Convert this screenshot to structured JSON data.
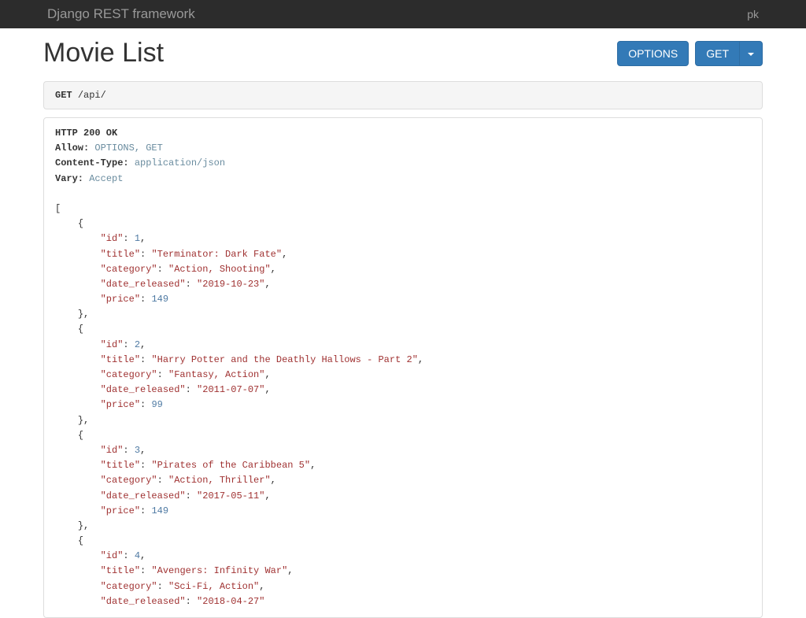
{
  "navbar": {
    "brand": "Django REST framework",
    "user": "pk"
  },
  "page": {
    "title": "Movie List"
  },
  "buttons": {
    "options": "OPTIONS",
    "get": "GET"
  },
  "request": {
    "method": "GET",
    "path": "/api/"
  },
  "response": {
    "status_line": "HTTP 200 OK",
    "headers": {
      "allow_label": "Allow:",
      "allow_value": "OPTIONS, GET",
      "content_type_label": "Content-Type:",
      "content_type_value": "application/json",
      "vary_label": "Vary:",
      "vary_value": "Accept"
    },
    "body": [
      {
        "id": 1,
        "title": "Terminator: Dark Fate",
        "category": "Action, Shooting",
        "date_released": "2019-10-23",
        "price": 149
      },
      {
        "id": 2,
        "title": "Harry Potter and the Deathly Hallows - Part 2",
        "category": "Fantasy, Action",
        "date_released": "2011-07-07",
        "price": 99
      },
      {
        "id": 3,
        "title": "Pirates of the Caribbean 5",
        "category": "Action, Thriller",
        "date_released": "2017-05-11",
        "price": 149
      },
      {
        "id": 4,
        "title": "Avengers: Infinity War",
        "category": "Sci-Fi, Action",
        "date_released": "2018-04-27"
      }
    ]
  }
}
